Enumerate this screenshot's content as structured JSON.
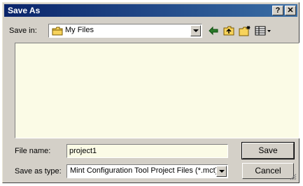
{
  "window": {
    "title": "Save As"
  },
  "titlebar_buttons": {
    "help": "?",
    "close": "✕"
  },
  "toolbar": {
    "save_in_label": "Save in:",
    "save_in_value": "My Files",
    "icons": [
      "back-arrow-icon",
      "up-folder-icon",
      "new-folder-icon",
      "view-menu-icon"
    ]
  },
  "form": {
    "file_name_label": "File name:",
    "file_name_value": "project1",
    "save_as_type_label": "Save as type:",
    "save_as_type_value": "Mint Configuration Tool Project Files (*.mct)"
  },
  "buttons": {
    "save": "Save",
    "cancel": "Cancel"
  },
  "colors": {
    "title_start": "#0a246a",
    "title_end": "#3a6ea5",
    "list_bg": "#fbfbe6",
    "face": "#d4d0c8"
  }
}
